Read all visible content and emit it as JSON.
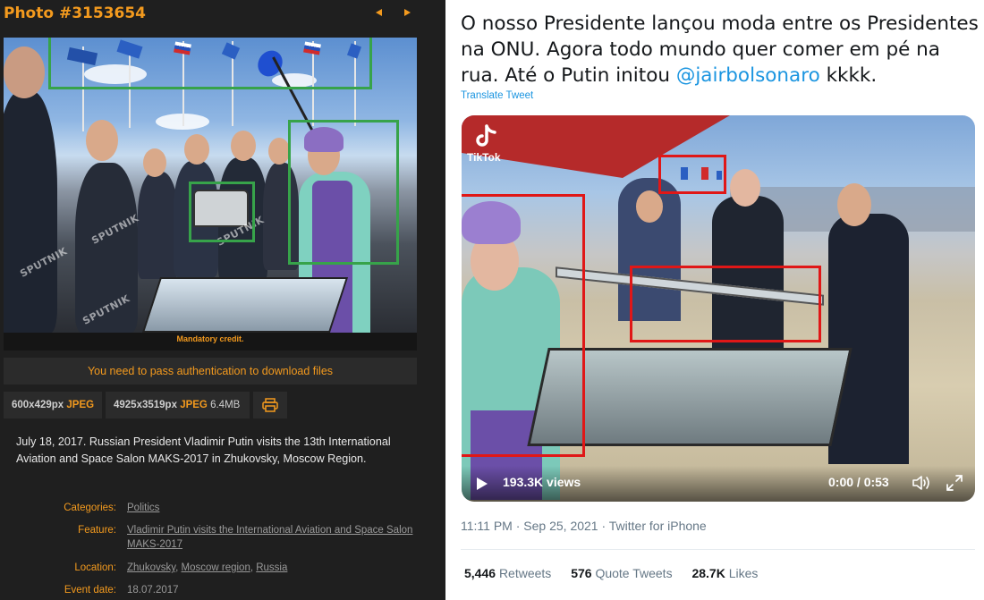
{
  "archive": {
    "photo_title": "Photo #3153654",
    "image_watermark": "SPUTNIK",
    "mandatory_credit": "Mandatory credit.",
    "auth_notice": "You need to pass authentication to download files",
    "downloads": [
      {
        "size": "600x429px",
        "format": "JPEG",
        "filesize": ""
      },
      {
        "size": "4925x3519px",
        "format": "JPEG",
        "filesize": "6.4MB"
      }
    ],
    "caption": "July 18, 2017. Russian President Vladimir Putin visits the 13th International Aviation and Space Salon MAKS-2017 in Zhukovsky, Moscow Region.",
    "meta": {
      "categories_label": "Categories:",
      "categories_value": "Politics",
      "feature_label": "Feature:",
      "feature_value": "Vladimir Putin visits the International Aviation and Space Salon MAKS-2017",
      "location_label": "Location:",
      "location_1": "Zhukovsky",
      "location_2": "Moscow region",
      "location_3": "Russia",
      "event_date_label": "Event date:",
      "event_date_value": "18.07.2017"
    }
  },
  "tweet": {
    "text_before": "O nosso Presidente lançou moda entre os Presidentes na ONU. Agora todo mundo quer comer em pé na rua. Até o Putin initou ",
    "mention": "@jairbolsonaro",
    "text_after": " kkkk.",
    "translate": "Translate Tweet",
    "video": {
      "tiktok_label": "TikTok",
      "views": "193.3K views",
      "time": "0:00 / 0:53"
    },
    "timestamp": "11:11 PM · Sep 25, 2021 · Twitter for iPhone",
    "stats": [
      {
        "count": "5,446",
        "label": "Retweets"
      },
      {
        "count": "576",
        "label": "Quote Tweets"
      },
      {
        "count": "28.7K",
        "label": "Likes"
      }
    ]
  },
  "colors": {
    "accent_orange": "#f39a1e",
    "highlight_green": "#37a34a",
    "highlight_red": "#e01717",
    "twitter_blue": "#1b95e0"
  }
}
